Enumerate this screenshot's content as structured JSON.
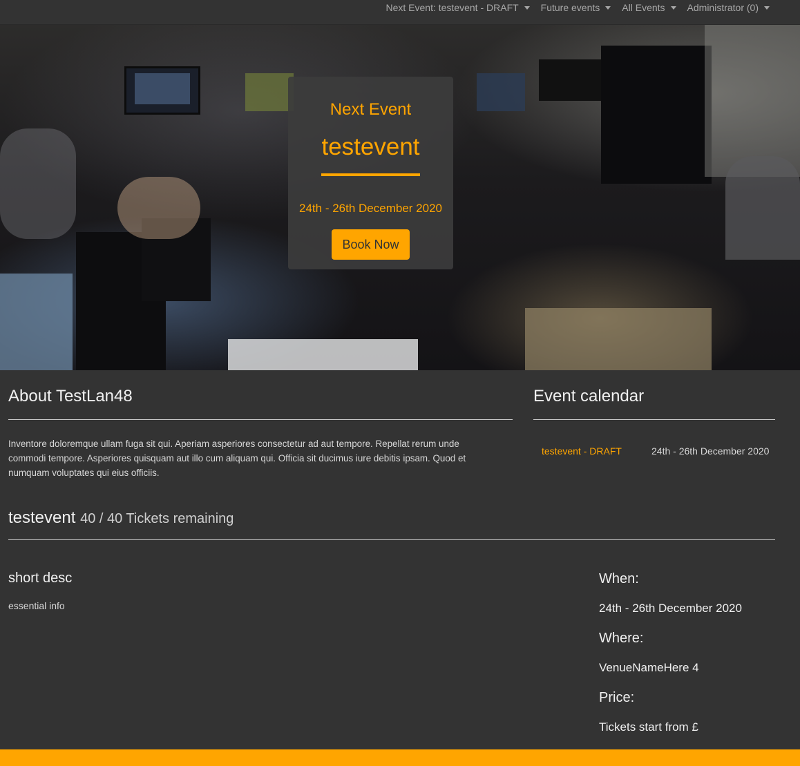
{
  "navbar": {
    "items": [
      {
        "label": "Next Event: testevent - DRAFT"
      },
      {
        "label": "Future events"
      },
      {
        "label": "All Events"
      },
      {
        "label": "Administrator (0)"
      }
    ]
  },
  "hero": {
    "label": "Next Event",
    "event_name": "testevent",
    "dates": "24th - 26th December 2020",
    "book_label": "Book Now"
  },
  "about": {
    "title": "About TestLan48",
    "text": "Inventore doloremque ullam fuga sit qui. Aperiam asperiores consectetur ad aut tempore. Repellat rerum unde commodi tempore. Asperiores quisquam aut illo cum aliquam qui. Officia sit ducimus iure debitis ipsam. Quod et numquam voluptates qui eius officiis."
  },
  "calendar": {
    "title": "Event calendar",
    "entries": [
      {
        "event": "testevent - DRAFT",
        "dates": "24th - 26th December 2020"
      }
    ]
  },
  "event": {
    "name": "testevent",
    "tickets": "40 / 40 Tickets remaining",
    "short_desc_title": "short desc",
    "short_desc_text": "essential info",
    "when_label": "When:",
    "when_value": "24th - 26th December 2020",
    "where_label": "Where:",
    "where_value": "VenueNameHere 4",
    "price_label": "Price:",
    "price_value": "Tickets start from £"
  },
  "colors": {
    "accent": "#ffa500",
    "background": "#333333"
  }
}
